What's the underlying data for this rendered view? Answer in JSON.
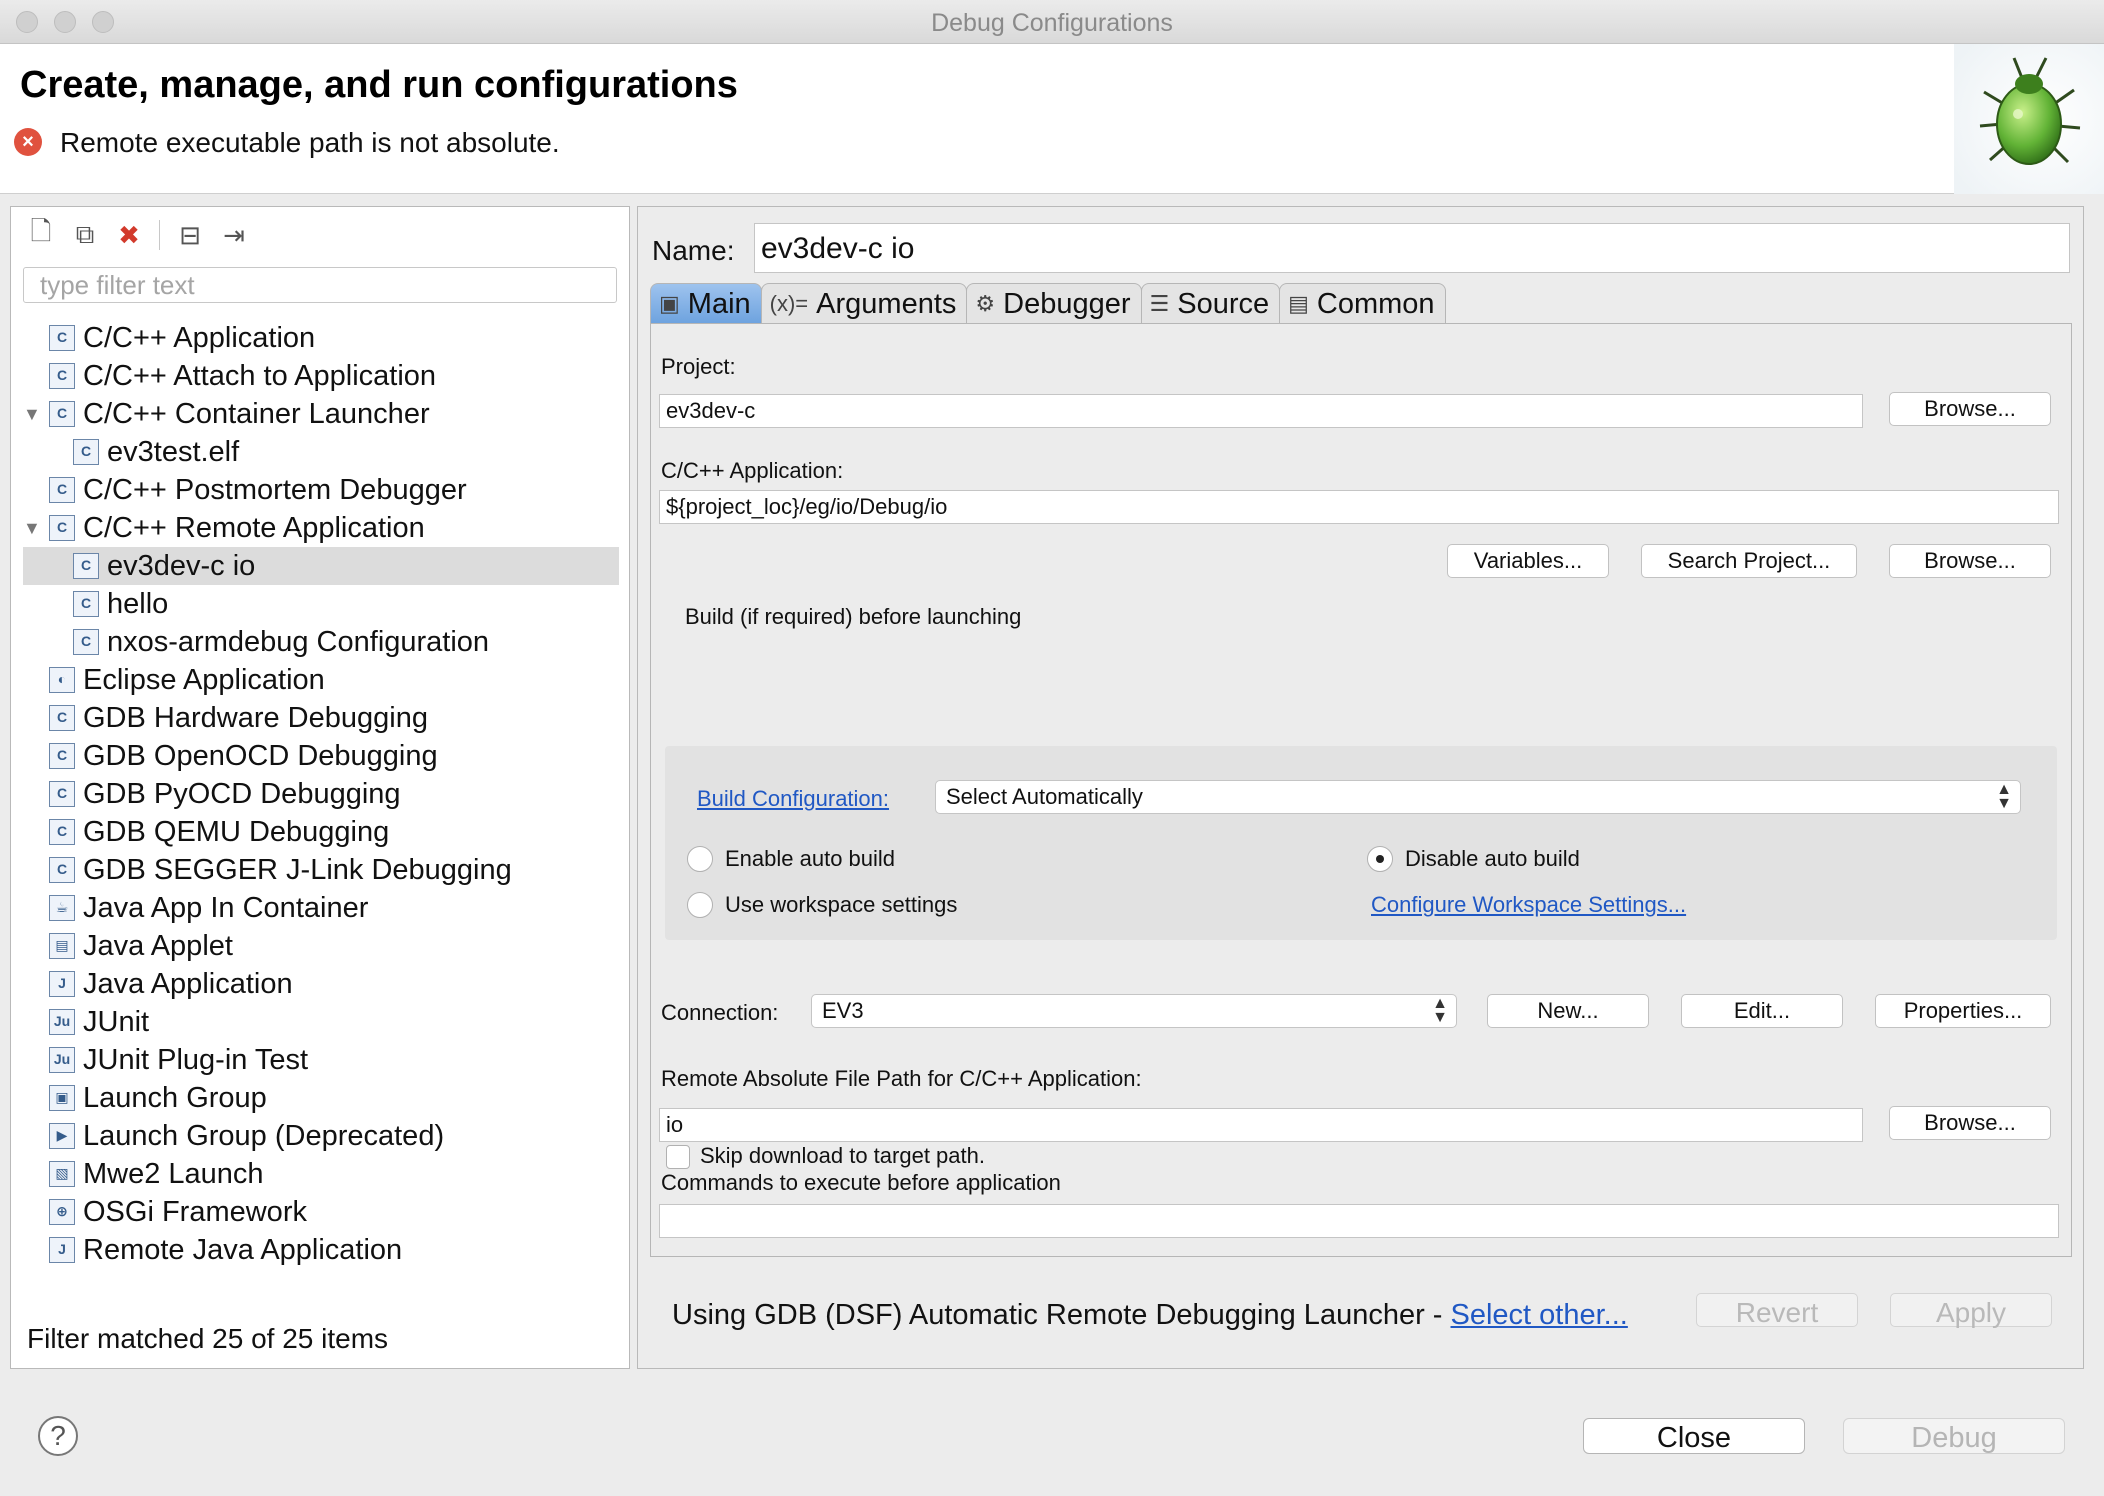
{
  "window": {
    "title": "Debug Configurations"
  },
  "header": {
    "heading": "Create, manage, and run configurations",
    "error_message": "Remote executable path is not absolute."
  },
  "left_panel": {
    "filter_placeholder": "type filter text",
    "status": "Filter matched 25 of 25 items",
    "toolbar": [
      {
        "name": "new-configuration-icon",
        "glyph": "🗋"
      },
      {
        "name": "duplicate-icon",
        "glyph": "⧉"
      },
      {
        "name": "delete-icon",
        "glyph": "✖"
      },
      {
        "name": "collapse-all-icon",
        "glyph": "⊟"
      },
      {
        "name": "filter-menu-icon",
        "glyph": "⇥"
      }
    ],
    "tree": [
      {
        "label": "C/C++ Application",
        "icon": "c-icon",
        "glyph": "C",
        "level": 0
      },
      {
        "label": "C/C++ Attach to Application",
        "icon": "c-icon",
        "glyph": "C",
        "level": 0
      },
      {
        "label": "C/C++ Container Launcher",
        "icon": "c-icon",
        "glyph": "C",
        "level": 0,
        "expanded": true
      },
      {
        "label": "ev3test.elf",
        "icon": "c-icon",
        "glyph": "C",
        "level": 1
      },
      {
        "label": "C/C++ Postmortem Debugger",
        "icon": "c-icon",
        "glyph": "C",
        "level": 0
      },
      {
        "label": "C/C++ Remote Application",
        "icon": "c-icon",
        "glyph": "C",
        "level": 0,
        "expanded": true
      },
      {
        "label": "ev3dev-c io",
        "icon": "c-icon",
        "glyph": "C",
        "level": 1,
        "selected": true
      },
      {
        "label": "hello",
        "icon": "c-icon",
        "glyph": "C",
        "level": 1
      },
      {
        "label": "nxos-armdebug Configuration",
        "icon": "c-icon",
        "glyph": "C",
        "level": 1
      },
      {
        "label": "Eclipse Application",
        "icon": "eclipse-icon",
        "glyph": "◐",
        "level": 0
      },
      {
        "label": "GDB Hardware Debugging",
        "icon": "c-icon",
        "glyph": "C",
        "level": 0
      },
      {
        "label": "GDB OpenOCD Debugging",
        "icon": "c-icon",
        "glyph": "C",
        "level": 0
      },
      {
        "label": "GDB PyOCD Debugging",
        "icon": "c-icon",
        "glyph": "C",
        "level": 0
      },
      {
        "label": "GDB QEMU Debugging",
        "icon": "c-icon",
        "glyph": "C",
        "level": 0
      },
      {
        "label": "GDB SEGGER J-Link Debugging",
        "icon": "c-icon",
        "glyph": "C",
        "level": 0
      },
      {
        "label": "Java App In Container",
        "icon": "java-container-icon",
        "glyph": "☕",
        "level": 0
      },
      {
        "label": "Java Applet",
        "icon": "java-applet-icon",
        "glyph": "▤",
        "level": 0
      },
      {
        "label": "Java Application",
        "icon": "java-application-icon",
        "glyph": "J",
        "level": 0
      },
      {
        "label": "JUnit",
        "icon": "junit-icon",
        "glyph": "Ju",
        "level": 0
      },
      {
        "label": "JUnit Plug-in Test",
        "icon": "junit-plugin-icon",
        "glyph": "Ju",
        "level": 0
      },
      {
        "label": "Launch Group",
        "icon": "launch-group-icon",
        "glyph": "▣",
        "level": 0
      },
      {
        "label": "Launch Group (Deprecated)",
        "icon": "launch-group-deprecated-icon",
        "glyph": "▶",
        "level": 0
      },
      {
        "label": "Mwe2 Launch",
        "icon": "mwe2-icon",
        "glyph": "▧",
        "level": 0
      },
      {
        "label": "OSGi Framework",
        "icon": "osgi-icon",
        "glyph": "⊕",
        "level": 0
      },
      {
        "label": "Remote Java Application",
        "icon": "remote-java-icon",
        "glyph": "J",
        "level": 0
      }
    ]
  },
  "right_panel": {
    "name_label": "Name:",
    "name_value": "ev3dev-c io",
    "tabs": [
      {
        "label": "Main",
        "icon": "main-tab-icon",
        "glyph": "▣",
        "active": true
      },
      {
        "label": "Arguments",
        "icon": "arguments-tab-icon",
        "glyph": "(x)=",
        "active": false
      },
      {
        "label": "Debugger",
        "icon": "debugger-tab-icon",
        "glyph": "⚙",
        "active": false
      },
      {
        "label": "Source",
        "icon": "source-tab-icon",
        "glyph": "☰",
        "active": false
      },
      {
        "label": "Common",
        "icon": "common-tab-icon",
        "glyph": "▤",
        "active": false
      }
    ],
    "main": {
      "project_label": "Project:",
      "project_value": "ev3dev-c",
      "browse_label": "Browse...",
      "app_label": "C/C++ Application:",
      "app_value": "${project_loc}/eg/io/Debug/io",
      "variables_label": "Variables...",
      "search_project_label": "Search Project...",
      "build_group_label": "Build (if required) before launching",
      "build_config_link": "Build Configuration:",
      "build_config_value": "Select Automatically",
      "enable_auto_build": "Enable auto build",
      "disable_auto_build": "Disable auto build",
      "use_workspace": "Use workspace settings",
      "configure_workspace_link": "Configure Workspace Settings...",
      "connection_label": "Connection:",
      "connection_value": "EV3",
      "new_label": "New...",
      "edit_label": "Edit...",
      "properties_label": "Properties...",
      "remote_path_label": "Remote Absolute File Path for C/C++ Application:",
      "remote_path_value": "io",
      "commands_label": "Commands to execute before application",
      "commands_value": "",
      "skip_download_label": "Skip download to target path."
    },
    "launcher_text": "Using GDB (DSF) Automatic Remote Debugging Launcher - ",
    "select_other": "Select other...",
    "revert_label": "Revert",
    "apply_label": "Apply"
  },
  "footer": {
    "help_glyph": "?",
    "close_label": "Close",
    "debug_label": "Debug"
  }
}
